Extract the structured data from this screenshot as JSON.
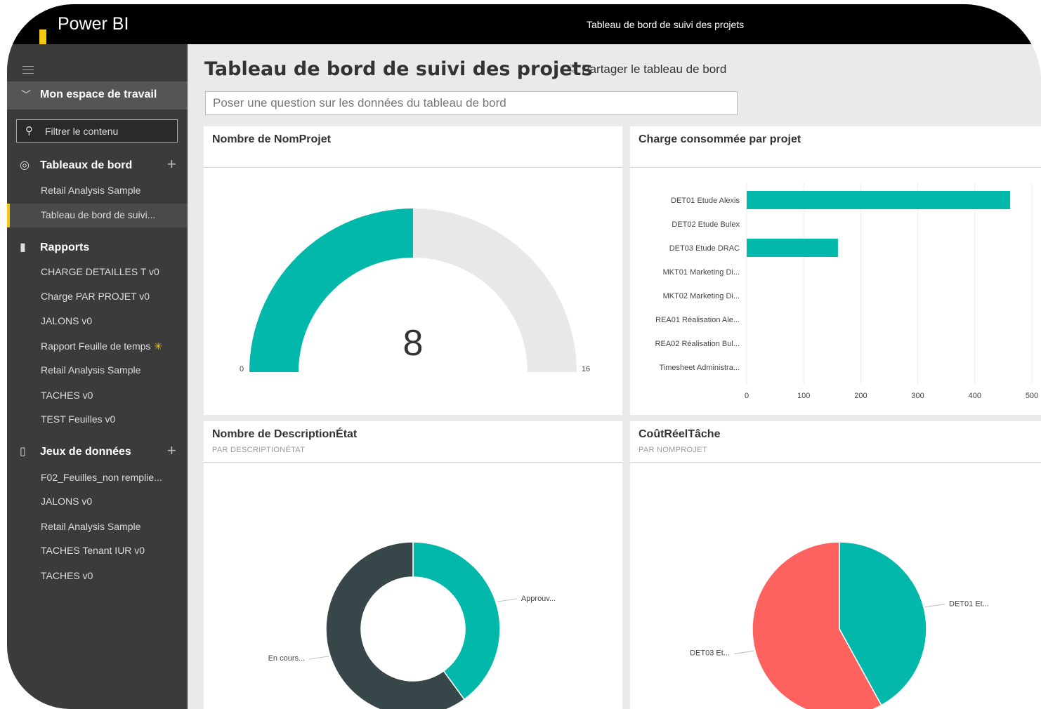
{
  "app": {
    "name": "Power BI",
    "window_title": "Tableau de bord de suivi des projets"
  },
  "sidebar": {
    "workspace": "Mon espace de travail",
    "filter_placeholder": "Filtrer le contenu",
    "sections": {
      "dashboards": {
        "label": "Tableaux de bord",
        "items": [
          "Retail Analysis Sample",
          "Tableau de bord de suivi..."
        ]
      },
      "reports": {
        "label": "Rapports",
        "items": [
          "CHARGE DETAILLES T v0",
          "Charge PAR PROJET v0",
          "JALONS v0",
          "Rapport Feuille de temps",
          "Retail Analysis Sample",
          "TACHES v0",
          "TEST Feuilles v0"
        ]
      },
      "datasets": {
        "label": "Jeux de données",
        "items": [
          "F02_Feuilles_non remplie...",
          "JALONS v0",
          "Retail Analysis Sample",
          "TACHES Tenant IUR v0",
          "TACHES v0"
        ]
      }
    },
    "active_item": "Tableau de bord de suivi..."
  },
  "dashboard": {
    "title": "Tableau de bord de suivi des projets",
    "share_label": "Partager le tableau de bord",
    "qa_placeholder": "Poser une question sur les données du tableau de bord"
  },
  "tiles": {
    "gauge": {
      "title": "Nombre de NomProjet"
    },
    "bars": {
      "title": "Charge consommée par projet"
    },
    "donut": {
      "title": "Nombre de DescriptionÉtat",
      "subtitle": "PAR DESCRIPTIONÉTAT"
    },
    "pie": {
      "title": "CoûtRéelTâche",
      "subtitle": "PAR NOMPROJET"
    }
  },
  "colors": {
    "teal": "#01b8aa",
    "dark": "#374649",
    "red": "#fd625e",
    "gauge_bg": "#e8e8e8",
    "accent": "#f2c811"
  },
  "chart_data": [
    {
      "type": "gauge",
      "title": "Nombre de NomProjet",
      "value": 8,
      "min": 0,
      "max": 16,
      "value_label": "8",
      "min_label": "0",
      "max_label": "16"
    },
    {
      "type": "bar",
      "orientation": "horizontal",
      "title": "Charge consommée par projet",
      "categories": [
        "DET01 Etude Alexis",
        "DET02 Etude Bulex",
        "DET03 Etude DRAC",
        "MKT01 Marketing Di...",
        "MKT02 Marketing Di...",
        "REA01 Réalisation Ale...",
        "REA02 Réalisation Bul...",
        "Timesheet Administra..."
      ],
      "values": [
        462,
        0,
        160,
        0,
        0,
        0,
        0,
        0
      ],
      "xlim": [
        0,
        500
      ],
      "xticks": [
        "0",
        "100",
        "200",
        "300",
        "400",
        "500"
      ]
    },
    {
      "type": "pie",
      "subtype": "donut",
      "title": "Nombre de DescriptionÉtat",
      "categories": [
        "Approuv...",
        "En cours..."
      ],
      "values": [
        40,
        60
      ]
    },
    {
      "type": "pie",
      "title": "CoûtRéelTâche",
      "categories": [
        "DET01 Et...",
        "DET03 Et..."
      ],
      "values": [
        42,
        58
      ]
    }
  ]
}
